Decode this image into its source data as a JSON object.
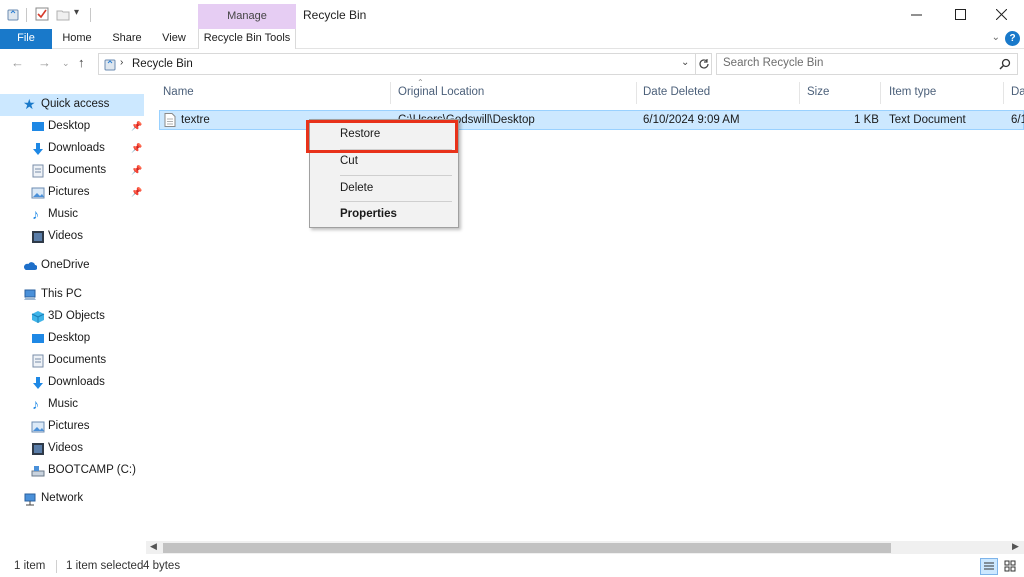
{
  "window": {
    "title": "Recycle Bin",
    "context_tab": "Manage",
    "minimize_icon": "minimize-icon",
    "maximize_icon": "maximize-icon",
    "close_icon": "close-icon"
  },
  "ribbon": {
    "tabs": [
      "File",
      "Home",
      "Share",
      "View"
    ],
    "context_tool": "Recycle Bin Tools",
    "help": "?"
  },
  "address": {
    "path": "Recycle Bin",
    "search_placeholder": "Search Recycle Bin"
  },
  "sidebar": {
    "quick_access": "Quick access",
    "quick_items": [
      {
        "label": "Desktop",
        "icon": "desktop-icon",
        "pinned": true
      },
      {
        "label": "Downloads",
        "icon": "download-icon",
        "pinned": true
      },
      {
        "label": "Documents",
        "icon": "documents-icon",
        "pinned": true
      },
      {
        "label": "Pictures",
        "icon": "pictures-icon",
        "pinned": true
      },
      {
        "label": "Music",
        "icon": "music-icon",
        "pinned": false
      },
      {
        "label": "Videos",
        "icon": "videos-icon",
        "pinned": false
      }
    ],
    "onedrive": "OneDrive",
    "this_pc": "This PC",
    "pc_items": [
      {
        "label": "3D Objects",
        "icon": "3d-objects-icon"
      },
      {
        "label": "Desktop",
        "icon": "desktop-icon"
      },
      {
        "label": "Documents",
        "icon": "documents-icon"
      },
      {
        "label": "Downloads",
        "icon": "download-icon"
      },
      {
        "label": "Music",
        "icon": "music-icon"
      },
      {
        "label": "Pictures",
        "icon": "pictures-icon"
      },
      {
        "label": "Videos",
        "icon": "videos-icon"
      },
      {
        "label": "BOOTCAMP (C:)",
        "icon": "drive-icon"
      }
    ],
    "network": "Network"
  },
  "columns": {
    "name": "Name",
    "original_location": "Original Location",
    "date_deleted": "Date Deleted",
    "size": "Size",
    "item_type": "Item type",
    "date_modified_partial": "Da"
  },
  "file": {
    "name": "textre",
    "original_location": "C:\\Users\\Godswill\\Desktop",
    "date_deleted": "6/10/2024 9:09 AM",
    "size": "1 KB",
    "item_type": "Text Document",
    "date_partial": "6/1"
  },
  "context_menu": {
    "restore": "Restore",
    "cut": "Cut",
    "delete": "Delete",
    "properties": "Properties"
  },
  "status": {
    "item_count": "1 item",
    "selected": "1 item selected",
    "size": "4 bytes"
  },
  "colors": {
    "accent": "#1979ca",
    "selection": "#cce8ff",
    "manage_tab": "#e6cdf3",
    "highlight_box": "#e8321a"
  }
}
